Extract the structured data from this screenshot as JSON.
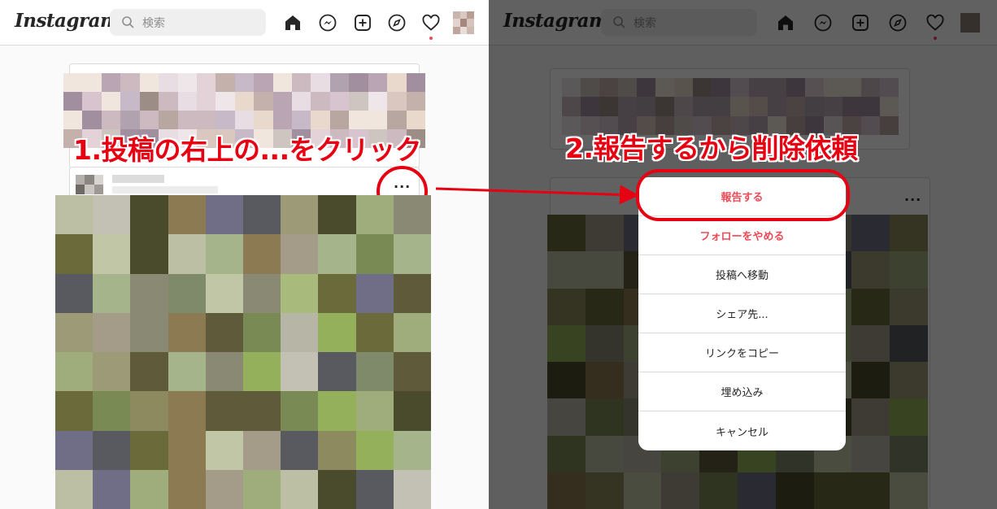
{
  "app": {
    "logo": "Instagram",
    "search_placeholder": "検索"
  },
  "instructions": {
    "step1": "1.投稿の右上の...をクリック",
    "step2": "2.報告するから削除依頼"
  },
  "post": {
    "more_label": "..."
  },
  "menu": {
    "items": [
      {
        "label": "報告する",
        "style": "danger"
      },
      {
        "label": "フォローをやめる",
        "style": "danger"
      },
      {
        "label": "投稿へ移動",
        "style": "normal"
      },
      {
        "label": "シェア先...",
        "style": "normal"
      },
      {
        "label": "リンクをコピー",
        "style": "normal"
      },
      {
        "label": "埋め込み",
        "style": "normal"
      },
      {
        "label": "キャンセル",
        "style": "normal"
      }
    ]
  },
  "nav_icons": [
    "home-icon",
    "messenger-icon",
    "new-post-icon",
    "explore-icon",
    "heart-icon"
  ],
  "colors": {
    "annotation": "#e60012",
    "danger": "#ed4956",
    "notification_dot": "#ed4956"
  }
}
